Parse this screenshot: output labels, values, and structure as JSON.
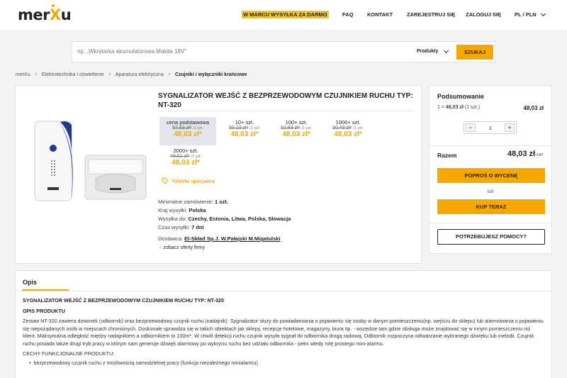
{
  "header": {
    "logo": "merXu",
    "nav": {
      "promo": "W MARCU WYSYŁKA ZA DARMO",
      "faq": "FAQ",
      "contact": "KONTAKT",
      "register": "ZAREJESTRUJ SIĘ",
      "login": "ZALOGUJ SIĘ",
      "lang": "PL / PLN"
    }
  },
  "search": {
    "placeholder": "np. „Wkrętarka akumulatorowa Makita 18V\"",
    "category": "Produkty",
    "button": "SZUKAJ"
  },
  "breadcrumb": [
    "merXu",
    "Elektrotechnika i oświetlenie",
    "Aparatura elektryczna",
    "Czujniki i wyłączniki krańcowe"
  ],
  "product": {
    "title": "SYGNALIZATOR WEJŚĆ Z BEZPRZEWODOWYM CZUJNIKIEM RUCHU TYP: NT-320",
    "tiers": [
      {
        "label": "cena podstawowa",
        "old": "57,63 zł*",
        "per": "/1 szt.",
        "new": "48,03 zł*"
      },
      {
        "label": "10+ szt.",
        "old": "55,23 zł*",
        "per": "/1 szt.",
        "new": "48,03 zł*"
      },
      {
        "label": "100+ szt.",
        "old": "52,83 zł*",
        "per": "/1 szt.",
        "new": "48,03 zł*"
      },
      {
        "label": "1000+ szt.",
        "old": "50,43 zł*",
        "per": "/1 szt.",
        "new": "48,03 zł*"
      },
      {
        "label": "2000+ szt.",
        "old": "48,51 zł*",
        "per": "/1 szt.",
        "new": "48,03 zł*"
      }
    ],
    "special_offer": "*Oferta specjalna",
    "details": {
      "min_order_label": "Minimalne zamówienie:",
      "min_order": "1 szt.",
      "country_label": "Kraj wysyłki:",
      "country": "Polska",
      "ship_to_label": "Wysyłka do:",
      "ship_to": "Czechy, Estonia, Litwa, Polska, Słowacja",
      "time_label": "Czas wysyłki:",
      "time": "7 dni"
    },
    "supplier_label": "Dostawca:",
    "supplier": "El-Skład Sp.J. W.Pałajski M.Migatulski",
    "offers_link": "zobacz oferty firmy"
  },
  "summary": {
    "title": "Podsumowanie",
    "line_qty": "1 ×",
    "line_price": "48,03 zł",
    "line_unit": "(1 szt.)",
    "line_total": "48,03 zł",
    "qty": "1",
    "minus": "−",
    "plus": "+",
    "total_label": "Razem",
    "total": "48,03 zł",
    "vat": "+VAT",
    "quote_button": "POPROŚ O WYCENĘ",
    "or": "lub",
    "buy_button": "KUP TERAZ",
    "help_button": "POTRZEBUJESZ POMOCY?"
  },
  "description": {
    "tab": "Opis",
    "heading": "SYGNALIZATOR WEJŚĆ Z BEZPRZEWODOWYM CZUJNIKIEM RUCHU TYP: NT-320",
    "subheading": "OPIS PRODUKTU",
    "paragraph1": "Zestaw NT-320 zawiera dzwonek (odbiornik) oraz bezprzewodowy czujnik ruchu (nadajnik). Sygnalizator służy do powiadamiania o pojawieniu się osoby w danym pomieszczeniu(np. wejściu do sklepu) lub alarmowania o pojawieniu się niepożądanych osób w miejscach chronionych. Doskonale sprawdza się w takich obiektach jak sklepy, recepcje hotelowe, magazyny, biura itp. - wszędzie tam gdzie obsługa może znajdować się w innym pomieszczeniu niż klient. Maksymalna odległość między nadajnikiem a odbiornikiem to 100m*. W chwili detekcji ruchu czujnik wysyła sygnał do odbiornika drogą radiową. Odbiornik rozpoczyna odtwarzanie wybranego dźwięku lub melodii. Czujnik ruchu posiada także drugi tryb pracy w którym sam generuje dźwięk alarmowy po wykryciu ruchu bez udziału odbiornika - pełni wtedy rolę prostego mini-alarmu.",
    "features_heading": "CECHY FUNKCJONALNE PRODUKTU:",
    "features": [
      "bezprzewodowy czujnik ruchu z możliwością samodzielnej pracy (funkcja niezależnego minialarmu)"
    ]
  },
  "colors": {
    "accent": "#f5a900",
    "promo": "#f5c518",
    "brand_blue": "#1f3a8a"
  }
}
